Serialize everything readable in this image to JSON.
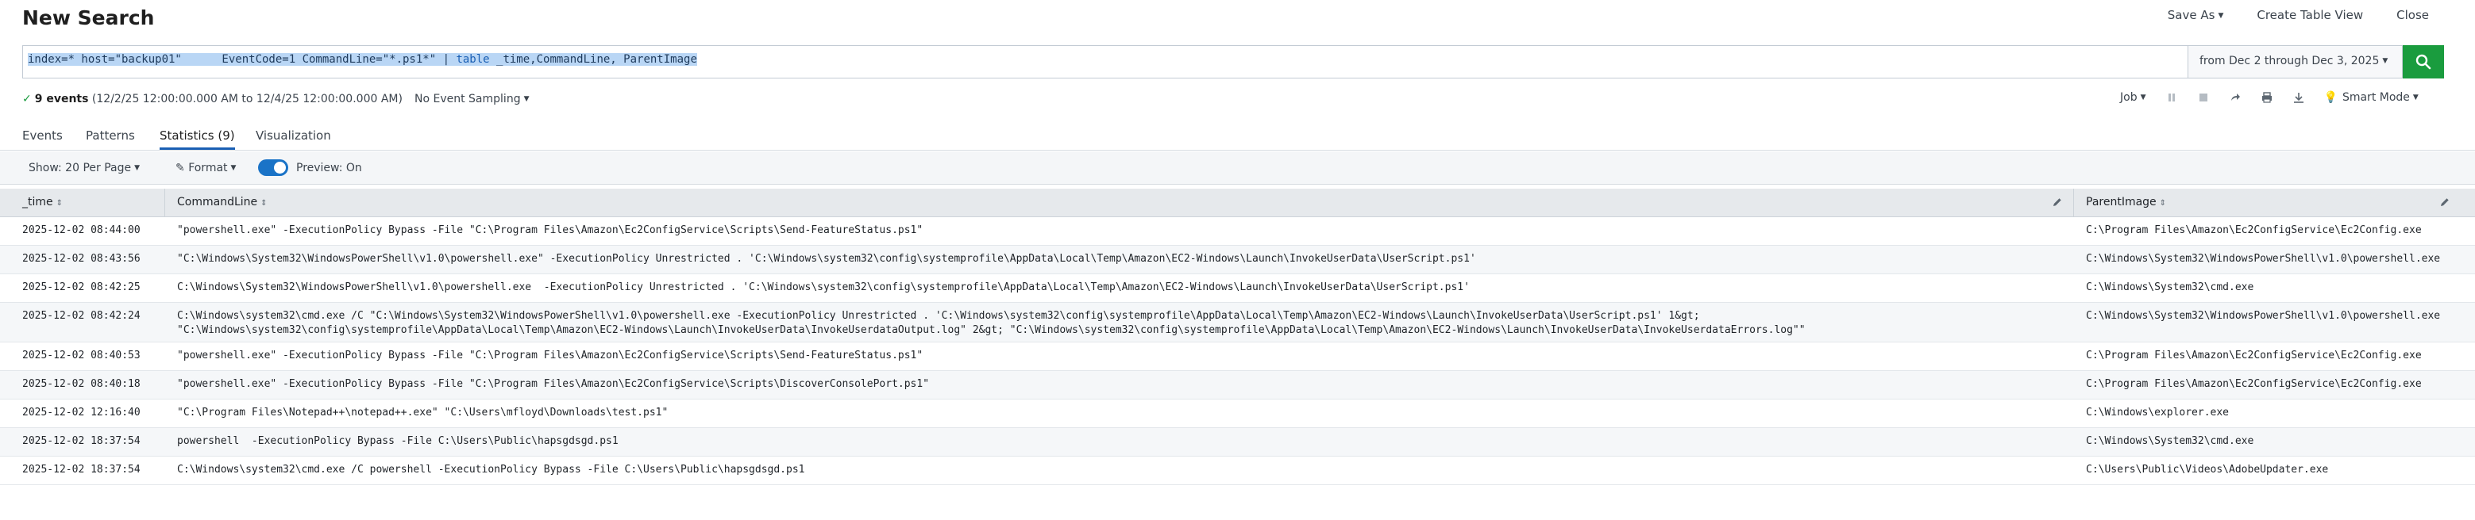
{
  "header": {
    "title": "New Search",
    "actions": [
      {
        "label": "Save As",
        "dropdown": true
      },
      {
        "label": "Create Table View",
        "dropdown": false
      },
      {
        "label": "Close",
        "dropdown": false
      }
    ]
  },
  "search": {
    "query_selected": "index=* host=\"backup01\"      EventCode=1 CommandLine=\"*.ps1*\" | ",
    "query_keyword": "table",
    "query_rest": " _time,CommandLine, ParentImage",
    "time_range": "from Dec 2 through Dec 3, 2025"
  },
  "status": {
    "count_text": "9 events",
    "range_text": "(12/2/25 12:00:00.000 AM to 12/4/25 12:00:00.000 AM)",
    "sampling": "No Event Sampling",
    "job": "Job",
    "mode": "Smart Mode"
  },
  "tabs": [
    {
      "label": "Events",
      "active": false
    },
    {
      "label": "Patterns",
      "active": false
    },
    {
      "label": "Statistics (9)",
      "active": true
    },
    {
      "label": "Visualization",
      "active": false
    }
  ],
  "toolbar": {
    "per_page": "Show: 20 Per Page",
    "format": "Format",
    "preview": "Preview: On"
  },
  "columns": [
    "_time",
    "CommandLine",
    "ParentImage"
  ],
  "rows": [
    {
      "time": "2025-12-02 08:44:00",
      "cmd": "\"powershell.exe\" -ExecutionPolicy Bypass -File \"C:\\Program Files\\Amazon\\Ec2ConfigService\\Scripts\\Send-FeatureStatus.ps1\"",
      "parent": "C:\\Program Files\\Amazon\\Ec2ConfigService\\Ec2Config.exe"
    },
    {
      "time": "2025-12-02 08:43:56",
      "cmd": "\"C:\\Windows\\System32\\WindowsPowerShell\\v1.0\\powershell.exe\" -ExecutionPolicy Unrestricted . 'C:\\Windows\\system32\\config\\systemprofile\\AppData\\Local\\Temp\\Amazon\\EC2-Windows\\Launch\\InvokeUserData\\UserScript.ps1'",
      "parent": "C:\\Windows\\System32\\WindowsPowerShell\\v1.0\\powershell.exe"
    },
    {
      "time": "2025-12-02 08:42:25",
      "cmd": "C:\\Windows\\System32\\WindowsPowerShell\\v1.0\\powershell.exe  -ExecutionPolicy Unrestricted . 'C:\\Windows\\system32\\config\\systemprofile\\AppData\\Local\\Temp\\Amazon\\EC2-Windows\\Launch\\InvokeUserData\\UserScript.ps1'",
      "parent": "C:\\Windows\\System32\\cmd.exe"
    },
    {
      "time": "2025-12-02 08:42:24",
      "cmd": "C:\\Windows\\system32\\cmd.exe /C \"C:\\Windows\\System32\\WindowsPowerShell\\v1.0\\powershell.exe -ExecutionPolicy Unrestricted . 'C:\\Windows\\system32\\config\\systemprofile\\AppData\\Local\\Temp\\Amazon\\EC2-Windows\\Launch\\InvokeUserData\\UserScript.ps1' 1&gt;\n\"C:\\Windows\\system32\\config\\systemprofile\\AppData\\Local\\Temp\\Amazon\\EC2-Windows\\Launch\\InvokeUserData\\InvokeUserdataOutput.log\" 2&gt; \"C:\\Windows\\system32\\config\\systemprofile\\AppData\\Local\\Temp\\Amazon\\EC2-Windows\\Launch\\InvokeUserData\\InvokeUserdataErrors.log\"\"",
      "parent": "C:\\Windows\\System32\\WindowsPowerShell\\v1.0\\powershell.exe"
    },
    {
      "time": "2025-12-02 08:40:53",
      "cmd": "\"powershell.exe\" -ExecutionPolicy Bypass -File \"C:\\Program Files\\Amazon\\Ec2ConfigService\\Scripts\\Send-FeatureStatus.ps1\"",
      "parent": "C:\\Program Files\\Amazon\\Ec2ConfigService\\Ec2Config.exe"
    },
    {
      "time": "2025-12-02 08:40:18",
      "cmd": "\"powershell.exe\" -ExecutionPolicy Bypass -File \"C:\\Program Files\\Amazon\\Ec2ConfigService\\Scripts\\DiscoverConsolePort.ps1\"",
      "parent": "C:\\Program Files\\Amazon\\Ec2ConfigService\\Ec2Config.exe"
    },
    {
      "time": "2025-12-02 12:16:40",
      "cmd": "\"C:\\Program Files\\Notepad++\\notepad++.exe\" \"C:\\Users\\mfloyd\\Downloads\\test.ps1\"",
      "parent": "C:\\Windows\\explorer.exe"
    },
    {
      "time": "2025-12-02 18:37:54",
      "cmd": "powershell  -ExecutionPolicy Bypass -File C:\\Users\\Public\\hapsgdsgd.ps1",
      "parent": "C:\\Windows\\System32\\cmd.exe"
    },
    {
      "time": "2025-12-02 18:37:54",
      "cmd": "C:\\Windows\\system32\\cmd.exe /C powershell -ExecutionPolicy Bypass -File C:\\Users\\Public\\hapsgdsgd.ps1",
      "parent": "C:\\Users\\Public\\Videos\\AdobeUpdater.exe"
    }
  ],
  "colors": {
    "accent": "#1a5fb4",
    "search_button": "#1a9c3e",
    "toggle": "#1a73c7"
  }
}
